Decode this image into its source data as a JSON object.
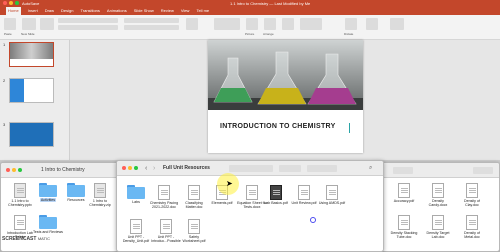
{
  "powerpoint": {
    "autosave_label": "AutoSave",
    "window_title": "1.1 Intro to Chemistry — Last Modified by Me",
    "menus": [
      "Home",
      "Insert",
      "Draw",
      "Design",
      "Transitions",
      "Animations",
      "Slide Show",
      "Review",
      "View",
      "Tell me"
    ],
    "active_menu": "Home",
    "ribbon_labels": [
      "Paste",
      "New Slide",
      "Reuse Slides",
      "Convert to SmartArt",
      "Picture",
      "Arrange",
      "Quick Styles",
      "Shape Fill",
      "Dictate",
      "Design Ideas",
      "Create and Share Adobe PDF"
    ],
    "slide_numbers": [
      "1",
      "2",
      "3"
    ],
    "slide_title": "INTRODUCTION TO CHEMISTRY",
    "brand_color": "#c3472b"
  },
  "finder_back": {
    "title": "1 Intro to Chemistry",
    "items": [
      {
        "label": "1.1 Intro to Chemistry.pptx",
        "kind": "doc"
      },
      {
        "label": "Activities",
        "kind": "folder"
      },
      {
        "label": "Resources",
        "kind": "folder"
      },
      {
        "label": "1 Intro to Chemistry.zip",
        "kind": "doc"
      },
      {
        "label": "Introduction Lab Safety",
        "kind": "doc"
      },
      {
        "label": "Tests and Reviews",
        "kind": "folder"
      }
    ]
  },
  "finder_front": {
    "title": "Full Unit Resources",
    "items": [
      {
        "label": "Labs",
        "kind": "folder"
      },
      {
        "label": "Chemistry Pacing 2021-2022.doc",
        "kind": "doc"
      },
      {
        "label": "Classifying Matter.doc",
        "kind": "doc"
      },
      {
        "label": "Elements.pdf",
        "kind": "doc"
      },
      {
        "label": "Equation Sheet for Tests.docx",
        "kind": "doc"
      },
      {
        "label": "Lab Basics.pdf",
        "kind": "dark"
      },
      {
        "label": "Unit Review.pdf",
        "kind": "doc"
      },
      {
        "label": "Using AMDS.pdf",
        "kind": "doc"
      },
      {
        "label": "Unit PPT - Density_Unit.pdf",
        "kind": "doc"
      },
      {
        "label": "Unit PPT - Introduc...Possible",
        "kind": "doc"
      },
      {
        "label": "Safety Worksheet.pdf",
        "kind": "doc"
      }
    ]
  },
  "finder_right": {
    "items": [
      {
        "label": "Accuracy.pdf"
      },
      {
        "label": "Density Candy.docx"
      },
      {
        "label": "Density of Clay.doc"
      },
      {
        "label": "Density Stacking Tube.doc"
      },
      {
        "label": "Density Target Lab.doc"
      },
      {
        "label": "Density of Metal.doc"
      }
    ]
  },
  "watermark": {
    "brand": "SCREENCAST",
    "suffix": "MATIC"
  }
}
